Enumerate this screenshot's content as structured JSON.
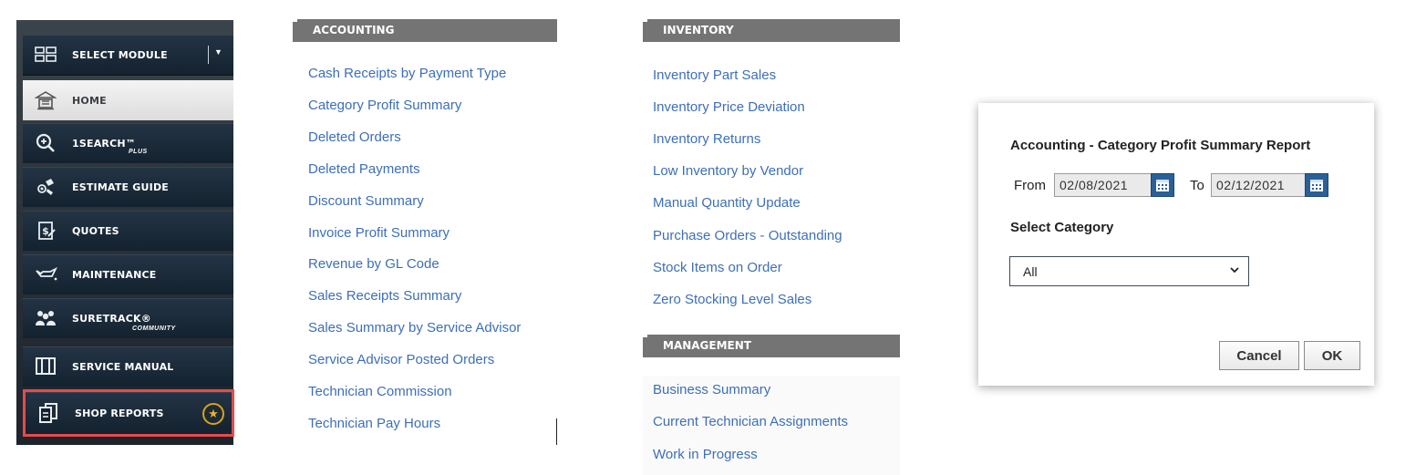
{
  "sidebar": {
    "select_module": "SELECT MODULE",
    "home": "HOME",
    "search": "1SEARCH™",
    "search_sub": "PLUS",
    "estimate_guide": "ESTIMATE GUIDE",
    "quotes": "QUOTES",
    "maintenance": "MAINTENANCE",
    "suretrack": "SURETRACK®",
    "suretrack_sub": "COMMUNITY",
    "service_manual": "SERVICE MANUAL",
    "shop_reports": "SHOP REPORTS",
    "highlight_color": "#e84a4a"
  },
  "accounting": {
    "header": "ACCOUNTING",
    "items": [
      "Cash Receipts by Payment Type",
      "Category Profit Summary",
      "Deleted Orders",
      "Deleted Payments",
      "Discount Summary",
      "Invoice Profit Summary",
      "Revenue by GL Code",
      "Sales Receipts Summary",
      "Sales Summary by Service Advisor",
      "Service Advisor Posted Orders",
      "Technician Commission",
      "Technician Pay Hours"
    ]
  },
  "inventory": {
    "header": "INVENTORY",
    "items": [
      "Inventory Part Sales",
      "Inventory Price Deviation",
      "Inventory Returns",
      "Low Inventory by Vendor",
      "Manual Quantity Update",
      "Purchase Orders - Outstanding",
      "Stock Items on Order",
      "Zero Stocking Level Sales"
    ]
  },
  "management": {
    "header": "MANAGEMENT",
    "items": [
      "Business Summary",
      "Current Technician Assignments",
      "Work in Progress"
    ]
  },
  "dialog": {
    "title": "Accounting - Category Profit Summary Report",
    "from_label": "From",
    "from_value": "02/08/2021",
    "to_label": "To",
    "to_value": "02/12/2021",
    "category_label": "Select Category",
    "category_value": "All",
    "cancel": "Cancel",
    "ok": "OK"
  },
  "colors": {
    "link": "#3d6fb6",
    "header_bg": "#747474",
    "calendar_button": "#2b5f98"
  }
}
